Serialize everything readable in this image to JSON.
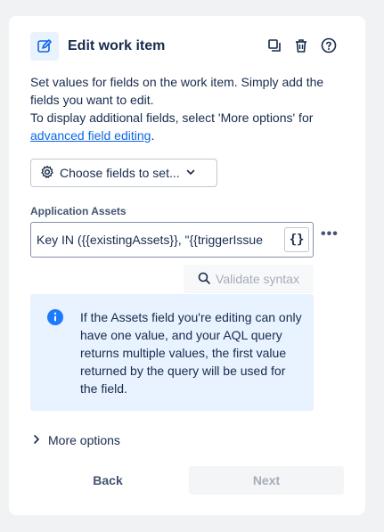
{
  "header": {
    "title": "Edit work item",
    "icon": "edit-icon",
    "actions": [
      "copy-icon",
      "trash-icon",
      "help-icon"
    ]
  },
  "description": {
    "line1": "Set values for fields on the work item. Simply add the fields you want to edit.",
    "line2_prefix": "To display additional fields, select 'More options' for",
    "link": "advanced field editing",
    "line2_suffix": "."
  },
  "choose_fields": {
    "label": "Choose fields to set...",
    "icon": "gear-icon",
    "caret": "chevron-down-icon"
  },
  "field": {
    "label": "Application Assets",
    "value": "Key IN ({{existingAssets}}, \"{{triggerIssue",
    "smart_value_button": "{}",
    "more_actions": "•••"
  },
  "validate": {
    "label": "Validate syntax",
    "icon": "search-icon"
  },
  "info": {
    "icon": "info-icon",
    "text": "If the Assets field you're editing can only have one value, and your AQL query returns multiple values, the first value returned by the query will be used for the field."
  },
  "more_options": {
    "label": "More options",
    "icon": "chevron-right-icon"
  },
  "footer": {
    "back_label": "Back",
    "next_label": "Next"
  },
  "colors": {
    "accent": "#0c66e4",
    "info_bg": "#e9f2ff",
    "disabled_text": "#a5adba"
  }
}
